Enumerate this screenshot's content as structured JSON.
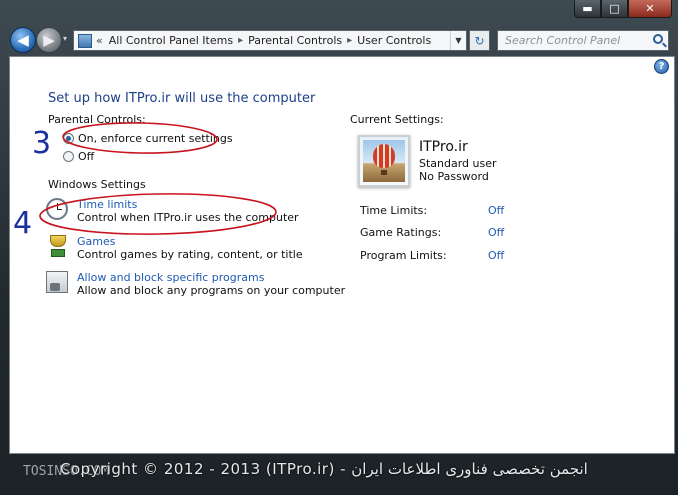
{
  "window": {
    "caption_buttons": {
      "minimize": "▬",
      "maximize": "□",
      "close": "✕"
    }
  },
  "nav": {
    "back_glyph": "◀",
    "forward_glyph": "▶",
    "history_glyph": "▾",
    "breadcrumb": [
      "All Control Panel Items",
      "Parental Controls",
      "User Controls"
    ],
    "breadcrumb_separator": "▸",
    "address_prefix": "«",
    "refresh_glyph": "↻",
    "search_placeholder": "Search Control Panel"
  },
  "help": {
    "glyph": "?"
  },
  "page": {
    "heading": "Set up how ITPro.ir will use the computer",
    "parental_controls_label": "Parental Controls:",
    "options": [
      {
        "label": "On, enforce current settings",
        "checked": true
      },
      {
        "label": "Off",
        "checked": false
      }
    ],
    "windows_settings_label": "Windows Settings",
    "settings": [
      {
        "icon": "clock-icon",
        "title": "Time limits",
        "description": "Control when ITPro.ir uses the computer"
      },
      {
        "icon": "trophy-icon",
        "title": "Games",
        "description": "Control games by rating, content, or title"
      },
      {
        "icon": "program-icon",
        "title": "Allow and block specific programs",
        "description": "Allow and block any programs on your computer"
      }
    ]
  },
  "current": {
    "label": "Current Settings:",
    "user_name": "ITPro.ir",
    "account_type": "Standard user",
    "password_status": "No Password",
    "rows": [
      {
        "label": "Time Limits:",
        "value": "Off"
      },
      {
        "label": "Game Ratings:",
        "value": "Off"
      },
      {
        "label": "Program Limits:",
        "value": "Off"
      }
    ]
  },
  "annotations": {
    "mark_3": "3",
    "mark_4": "4",
    "color": "#c8141e",
    "pen_color": "#1a2fa0"
  },
  "watermark": {
    "text": "Copyright © 2012 - 2013 (ITPro.ir) - انجمن تخصصی فناوری اطلاعات ایران",
    "left_text": "TOSINSO.COM"
  }
}
